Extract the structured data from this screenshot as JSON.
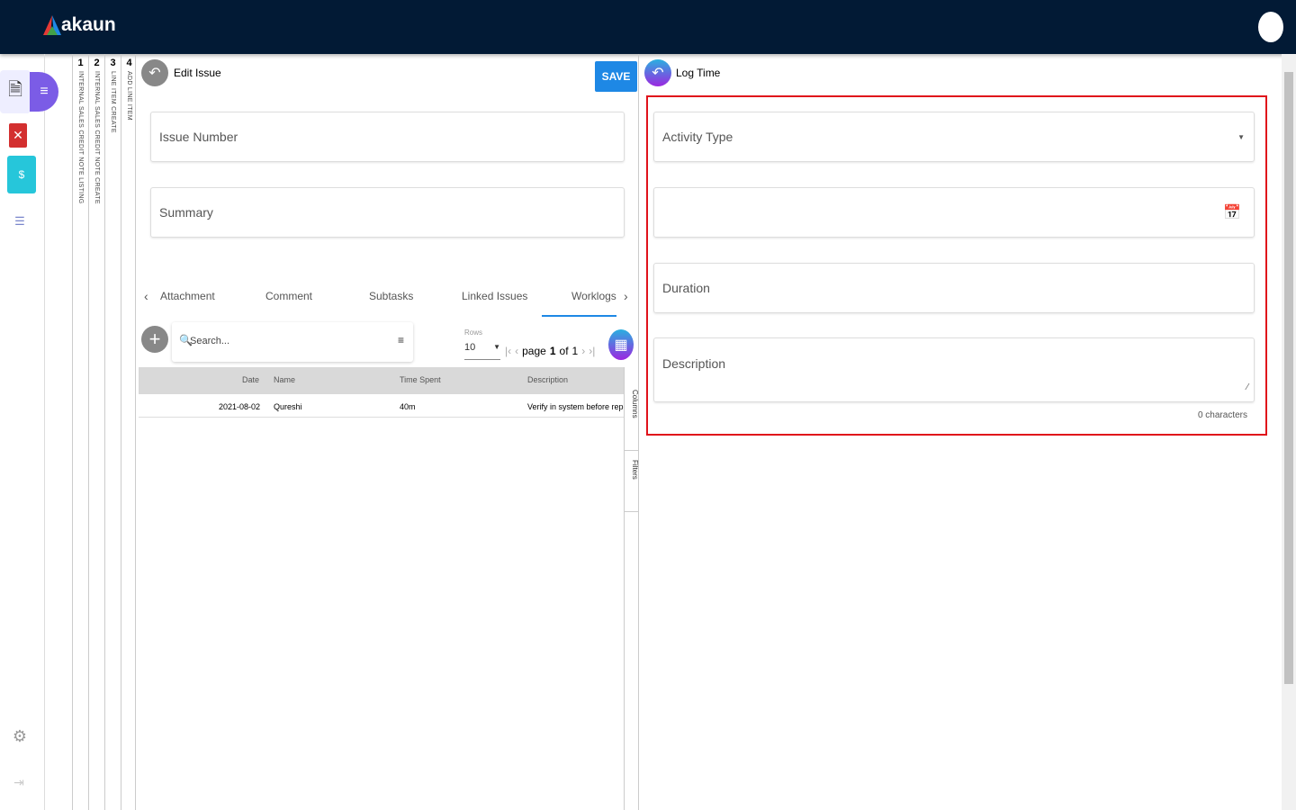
{
  "header": {
    "brand": "akaun"
  },
  "sidebar": {
    "icons": [
      "credit-note-icon",
      "pdf-icon",
      "invoice-icon",
      "list-icon",
      "settings-icon",
      "logout-icon"
    ]
  },
  "vertical_tabs": [
    {
      "num": "1",
      "label": "INTERNAL SALES CREDIT NOTE LISTING"
    },
    {
      "num": "2",
      "label": "INTERNAL SALES CREDIT NOTE CREATE"
    },
    {
      "num": "3",
      "label": "LINE ITEM CREATE"
    },
    {
      "num": "4",
      "label": "ADD LINE ITEM"
    }
  ],
  "edit_issue": {
    "title": "Edit Issue",
    "save": "SAVE",
    "issue_number": "Issue Number",
    "summary": "Summary",
    "tabs": [
      "Attachment",
      "Comment",
      "Subtasks",
      "Linked Issues",
      "Worklogs"
    ],
    "active_tab": "Worklogs",
    "search_placeholder": "Search...",
    "rows_label": "Rows",
    "rows_value": "10",
    "page_label": "page",
    "page": "1",
    "of_label": "of",
    "total_pages": "1",
    "columns": [
      "Date",
      "Name",
      "Time Spent",
      "Description"
    ],
    "rows": [
      {
        "date": "2021-08-02",
        "name": "Qureshi",
        "time": "40m",
        "description": "Verify in system before replying"
      }
    ],
    "side_columns": "Columns",
    "side_filters": "Filters"
  },
  "log_time": {
    "title": "Log Time",
    "activity_type": "Activity Type",
    "date": "",
    "duration": "Duration",
    "description": "Description",
    "char_count": "0 characters"
  },
  "colors": {
    "topbar": "#021a35",
    "accent": "#1e88e5",
    "highlight": "#e0121b"
  }
}
